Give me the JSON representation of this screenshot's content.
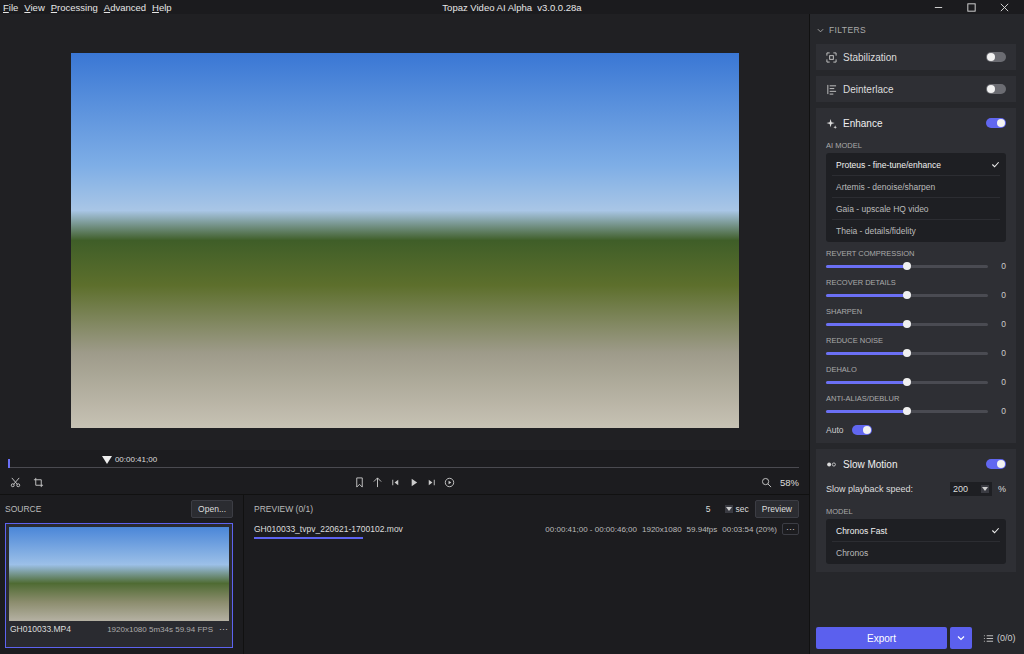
{
  "window": {
    "title": "Topaz Video AI Alpha  v3.0.0.28a"
  },
  "menu": [
    "File",
    "View",
    "Processing",
    "Advanced",
    "Help"
  ],
  "timeline": {
    "timecode": "00:00:41;00",
    "level": 0.125
  },
  "viewer": {
    "zoom": "58%"
  },
  "source": {
    "label": "SOURCE",
    "open_button": "Open...",
    "files": [
      {
        "name": "GH010033.MP4",
        "info": "1920x1080 5m34s 59.94 FPS",
        "more": "···",
        "selected": true
      }
    ]
  },
  "preview": {
    "label": "PREVIEW (0/1)",
    "duration": "5",
    "unit": "sec",
    "button": "Preview",
    "items": [
      {
        "name": "GH010033_tvpv_220621-1700102.mov",
        "range": "00:00:41;00 - 00:00:46;00",
        "resolution": "1920x1080",
        "fps": "59.94fps",
        "time": "00:03:54 (20%)",
        "level": 0.2,
        "more": "···"
      }
    ]
  },
  "filters": {
    "title": "FILTERS",
    "stabilization": {
      "label": "Stabilization",
      "on": false
    },
    "deinterlace": {
      "label": "Deinterlace",
      "on": false
    },
    "enhance": {
      "label": "Enhance",
      "on": true,
      "model_label": "AI MODEL",
      "models": [
        {
          "label": "Proteus - fine-tune/enhance",
          "selected": true
        },
        {
          "label": "Artemis - denoise/sharpen",
          "selected": false
        },
        {
          "label": "Gaia - upscale HQ video",
          "selected": false
        },
        {
          "label": "Theia - details/fidelity",
          "selected": false
        }
      ],
      "sliders": [
        {
          "label": "REVERT COMPRESSION",
          "level": 0.5,
          "reading": "0"
        },
        {
          "label": "RECOVER DETAILS",
          "level": 0.5,
          "reading": "0"
        },
        {
          "label": "SHARPEN",
          "level": 0.5,
          "reading": "0"
        },
        {
          "label": "REDUCE NOISE",
          "level": 0.5,
          "reading": "0"
        },
        {
          "label": "DEHALO",
          "level": 0.5,
          "reading": "0"
        },
        {
          "label": "ANTI-ALIAS/DEBLUR",
          "level": 0.5,
          "reading": "0"
        }
      ],
      "auto": {
        "label": "Auto",
        "on": true
      }
    },
    "slow_motion": {
      "label": "Slow Motion",
      "on": true,
      "speed_label": "Slow playback speed:",
      "speed": "200",
      "unit": "%",
      "model_label": "MODEL",
      "models": [
        {
          "label": "Chronos Fast",
          "selected": true
        },
        {
          "label": "Chronos",
          "selected": false
        }
      ]
    }
  },
  "export": {
    "label": "Export",
    "queue": "(0/0)"
  }
}
